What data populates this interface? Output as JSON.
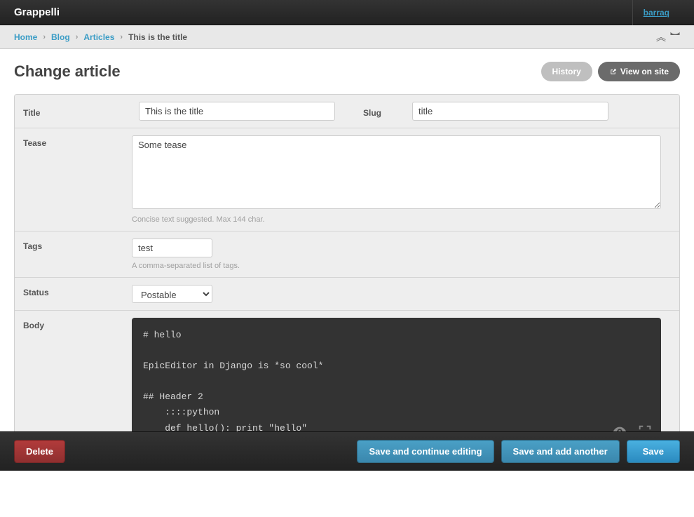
{
  "header": {
    "branding": "Grappelli",
    "username": "barraq"
  },
  "breadcrumbs": {
    "home": "Home",
    "app": "Blog",
    "model": "Articles",
    "current": "This is the title"
  },
  "page": {
    "title": "Change article",
    "history_label": "History",
    "view_label": "View on site"
  },
  "form": {
    "title_label": "Title",
    "title_value": "This is the title",
    "slug_label": "Slug",
    "slug_value": "title",
    "tease_label": "Tease",
    "tease_value": "Some tease",
    "tease_help": "Concise text suggested. Max 144 char.",
    "tags_label": "Tags",
    "tags_value": "test",
    "tags_help": "A comma-separated list of tags.",
    "status_label": "Status",
    "status_value": "Postable",
    "body_label": "Body",
    "body_value": "# hello\n\nEpicEditor in Django is *so cool*\n\n## Header 2\n    ::::python\n    def hello(): print \"hello\""
  },
  "actions": {
    "delete": "Delete",
    "save_continue": "Save and continue editing",
    "save_add": "Save and add another",
    "save": "Save"
  }
}
